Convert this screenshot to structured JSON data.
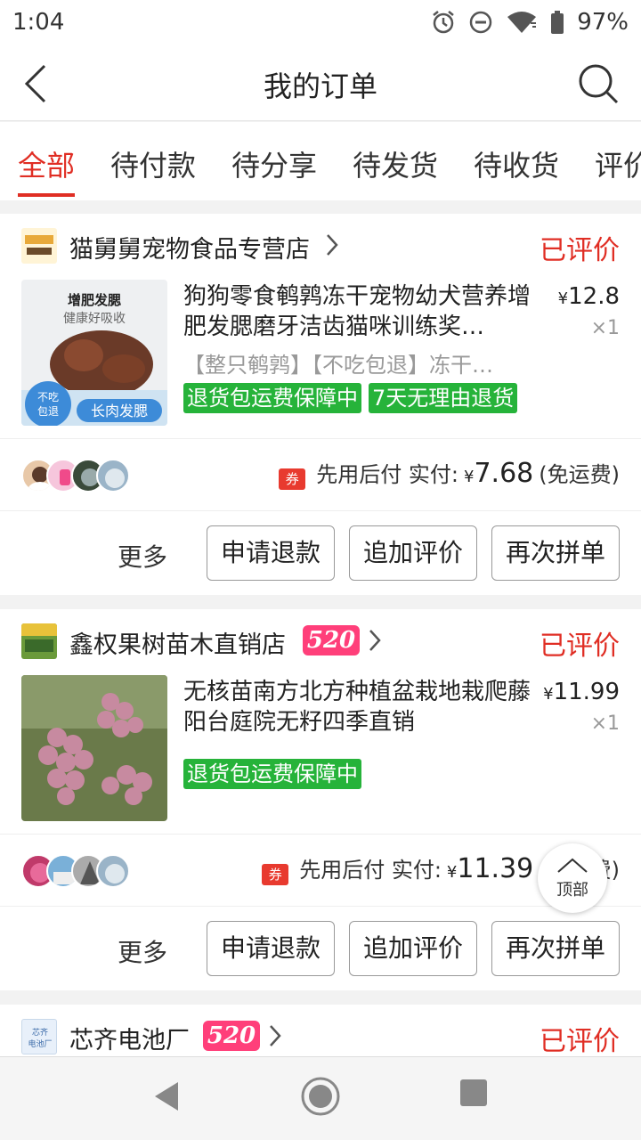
{
  "status_bar": {
    "time": "1:04",
    "battery": "97%"
  },
  "header": {
    "title": "我的订单"
  },
  "tabs": [
    {
      "label": "全部",
      "active": true
    },
    {
      "label": "待付款"
    },
    {
      "label": "待分享"
    },
    {
      "label": "待发货"
    },
    {
      "label": "待收货"
    },
    {
      "label": "评价"
    }
  ],
  "orders": [
    {
      "store_name": "猫舅舅宠物食品专营店",
      "status": "已评价",
      "product_title": "狗狗零食鹌鹑冻干宠物幼犬营养增肥发腮磨牙洁齿猫咪训练奖…",
      "product_spec": "【整只鹌鹑】【不吃包退】冻干…",
      "price": "12.8",
      "currency": "¥",
      "qty": "×1",
      "tags": [
        "退货包运费保障中",
        "7天无理由退货"
      ],
      "thumb_text_top": "增肥发腮",
      "thumb_text_mid": "健康好吸收",
      "thumb_badge": "不吃包退",
      "thumb_bottom": "长肉发腮",
      "pay_coupon": "券",
      "pay_label": "先用后付 实付:",
      "pay_amount": "7.68",
      "pay_note": "(免运费)",
      "more": "更多",
      "btn1": "申请退款",
      "btn2": "追加评价",
      "btn3": "再次拼单"
    },
    {
      "store_name": "鑫权果树苗木直销店",
      "badge": "520",
      "status": "已评价",
      "product_title": "无核苗南方北方种植盆栽地栽爬藤阳台庭院无籽四季直销",
      "price": "11.99",
      "currency": "¥",
      "qty": "×1",
      "tags": [
        "退货包运费保障中"
      ],
      "pay_coupon": "券",
      "pay_label": "先用后付 实付:",
      "pay_amount": "11.39",
      "pay_note": "(免运费)",
      "more": "更多",
      "btn1": "申请退款",
      "btn2": "追加评价",
      "btn3": "再次拼单"
    },
    {
      "store_name": "芯齐电池厂",
      "store_logo_text": "芯齐电池厂",
      "badge": "520",
      "status": "已评价"
    }
  ],
  "back_to_top": "顶部",
  "colors": {
    "accent": "#e02e24",
    "tag_green": "#26b33a",
    "badge_pink": "#ff3f7a"
  }
}
